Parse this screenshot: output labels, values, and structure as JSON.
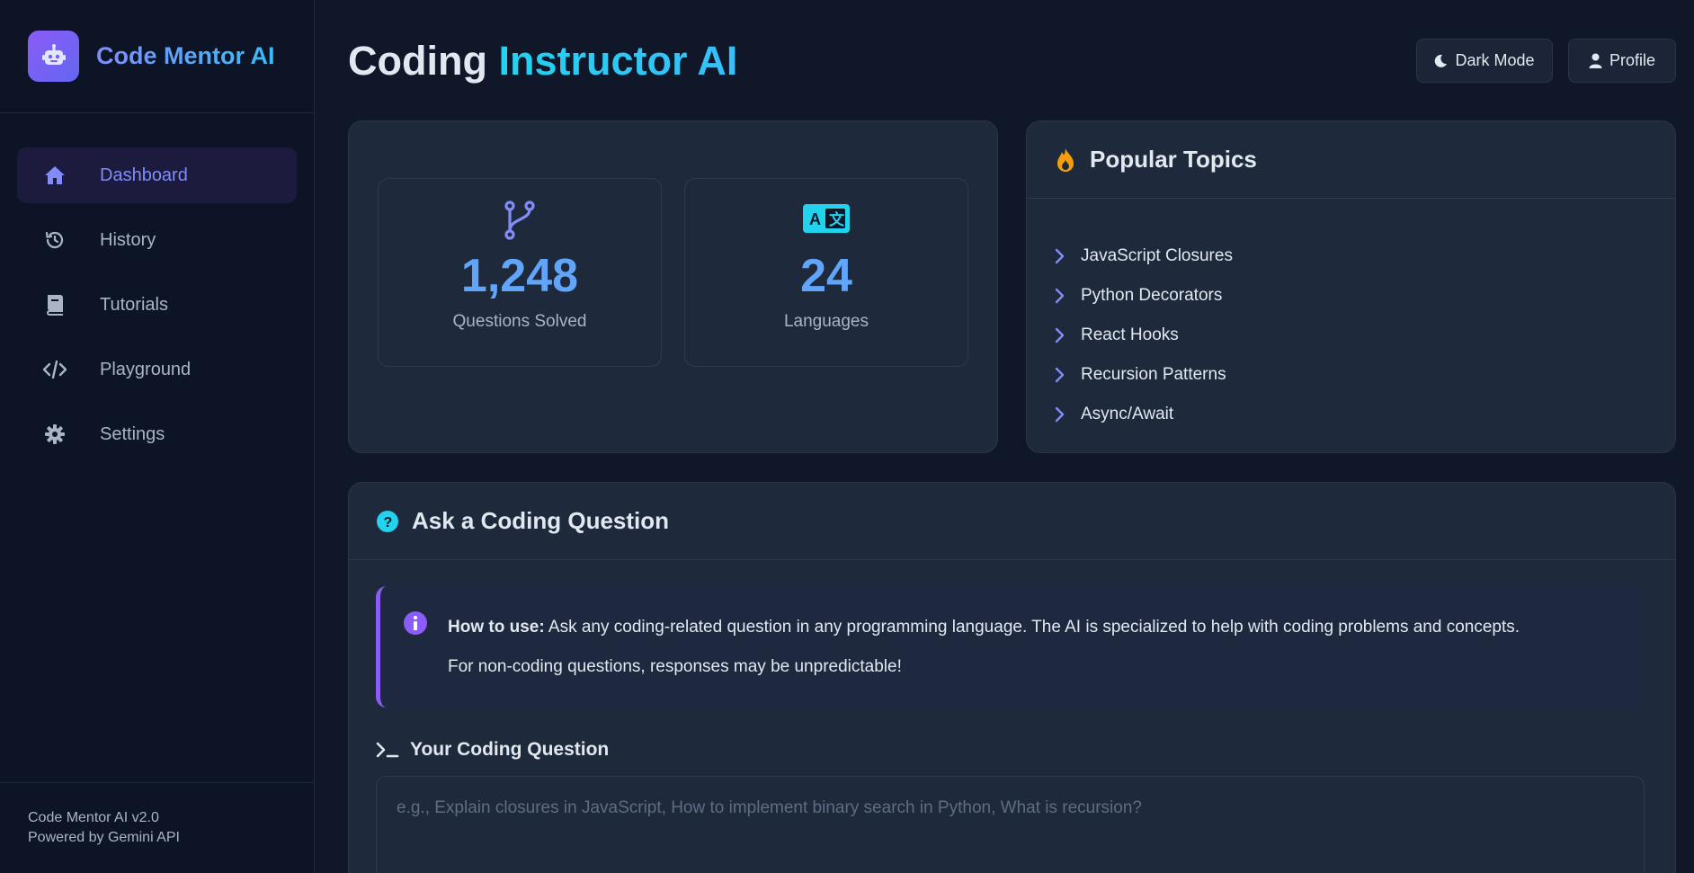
{
  "brand": {
    "title": "Code Mentor AI"
  },
  "nav": {
    "items": [
      {
        "label": "Dashboard",
        "icon": "home-icon",
        "active": true
      },
      {
        "label": "History",
        "icon": "history-icon",
        "active": false
      },
      {
        "label": "Tutorials",
        "icon": "book-icon",
        "active": false
      },
      {
        "label": "Playground",
        "icon": "code-icon",
        "active": false
      },
      {
        "label": "Settings",
        "icon": "gear-icon",
        "active": false
      }
    ]
  },
  "footer": {
    "version": "Code Mentor AI v2.0",
    "powered": "Powered by Gemini API"
  },
  "header": {
    "title_part1": "Coding ",
    "title_part2": "Instructor AI",
    "dark_mode_label": "Dark Mode",
    "profile_label": "Profile"
  },
  "stats": [
    {
      "value": "1,248",
      "label": "Questions Solved",
      "icon": "git-branch-icon"
    },
    {
      "value": "24",
      "label": "Languages",
      "icon": "language-icon"
    }
  ],
  "topics": {
    "title": "Popular Topics",
    "icon": "fire-icon",
    "items": [
      "JavaScript Closures",
      "Python Decorators",
      "React Hooks",
      "Recursion Patterns",
      "Async/Await"
    ]
  },
  "ask": {
    "title": "Ask a Coding Question",
    "info_bold": "How to use:",
    "info_line1": " Ask any coding-related question in any programming language. The AI is specialized to help with coding problems and concepts.",
    "info_line2": "For non-coding questions, responses may be unpredictable!",
    "question_label": "Your Coding Question",
    "placeholder": "e.g., Explain closures in JavaScript, How to implement binary search in Python, What is recursion?",
    "value": ""
  },
  "colors": {
    "accent": "#818cf8",
    "cyan": "#22d3ee",
    "stat": "#60a5fa",
    "fire": "#f59e0b"
  }
}
